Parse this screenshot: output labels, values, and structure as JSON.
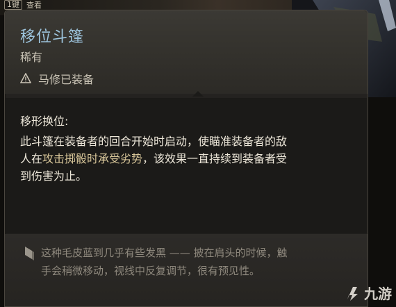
{
  "top_bar": {
    "hotkey_badge": "1键",
    "inspect_label": "查看"
  },
  "tooltip": {
    "title": "移位斗篷",
    "rarity": "稀有",
    "equipped_text": "马修已装备",
    "effect_name": "移形换位:",
    "effect_desc_part1": "此斗篷在装备者的回合开始时启动，使瞄准装备者的敌人在",
    "effect_highlight": "攻击掷骰时承受劣势",
    "effect_desc_part2": "，该效果一直持续到装备者受到伤害为止。",
    "flavor_text": "这种毛皮蓝到几乎有些发黑 —— 披在肩头的时候，触手会稍微移动，视线中反复调节，很有预见性。"
  },
  "watermark": {
    "brand": "九游"
  },
  "colors": {
    "title": "#9ec5de",
    "highlight": "#d9c79a",
    "flavor": "#8e887d"
  }
}
